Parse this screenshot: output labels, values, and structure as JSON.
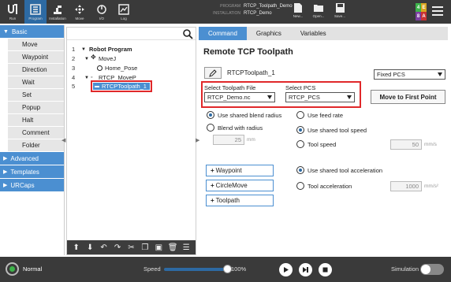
{
  "topbar": {
    "buttons": [
      {
        "label": "Run",
        "icon": "ur-logo-icon"
      },
      {
        "label": "Program",
        "icon": "program-icon"
      },
      {
        "label": "Installation",
        "icon": "installation-icon"
      },
      {
        "label": "Move",
        "icon": "move-icon"
      },
      {
        "label": "I/O",
        "icon": "io-icon"
      },
      {
        "label": "Log",
        "icon": "log-icon"
      }
    ],
    "program_key": "PROGRAM",
    "program_value": "RTCP_Toolpath_Demo",
    "installation_key": "INSTALLATION",
    "installation_value": "RTCP_Demo",
    "file_buttons": [
      {
        "label": "New...",
        "icon": "new-file-icon"
      },
      {
        "label": "Open...",
        "icon": "open-file-icon"
      },
      {
        "label": "Save...",
        "icon": "save-icon"
      }
    ],
    "tiles": [
      {
        "text": "4",
        "color": "#3db34a"
      },
      {
        "text": "E",
        "color": "#d9a520"
      },
      {
        "text": "8",
        "color": "#7b3fa0"
      },
      {
        "text": "A",
        "color": "#c83232"
      }
    ]
  },
  "leftnav": {
    "basic_label": "Basic",
    "items": [
      "Move",
      "Waypoint",
      "Direction",
      "Wait",
      "Set",
      "Popup",
      "Halt",
      "Comment",
      "Folder"
    ],
    "advanced_label": "Advanced",
    "templates_label": "Templates",
    "urcaps_label": "URCaps"
  },
  "tree": {
    "rows": [
      {
        "num": "1",
        "text": "Robot Program",
        "toggle": "▼"
      },
      {
        "num": "2",
        "text": "MoveJ",
        "toggle": "▼"
      },
      {
        "num": "3",
        "text": "Home_Pose",
        "toggle": ""
      },
      {
        "num": "4",
        "text": "RTCP_MoveP",
        "toggle": "▼"
      },
      {
        "num": "5",
        "text": "RTCPToolpath_1",
        "toggle": ""
      }
    ],
    "toolbar_icons": [
      "move-up-icon",
      "move-down-icon",
      "undo-icon",
      "redo-icon",
      "cut-icon",
      "copy-icon",
      "paste-icon",
      "delete-icon",
      "suppress-icon"
    ]
  },
  "tabs": [
    "Command",
    "Graphics",
    "Variables"
  ],
  "panel": {
    "title": "Remote TCP Toolpath",
    "node_name": "RTCPToolpath_1",
    "pcs_mode": "Fixed PCS",
    "toolpath_file_label": "Select Toolpath File",
    "toolpath_file_value": "RTCP_Demo.nc",
    "pcs_label": "Select PCS",
    "pcs_value": "RTCP_PCS",
    "move_first_point": "Move to First Point",
    "blend": {
      "shared_label": "Use shared blend radius",
      "radius_label": "Blend with radius",
      "radius_value": "25",
      "radius_unit": "mm",
      "shared_selected": true
    },
    "speed": {
      "feed_rate_label": "Use feed rate",
      "shared_label": "Use shared tool speed",
      "tool_label": "Tool speed",
      "tool_value": "50",
      "tool_unit": "mm/s",
      "selected": "shared"
    },
    "accel": {
      "shared_label": "Use shared tool acceleration",
      "tool_label": "Tool acceleration",
      "tool_value": "1000",
      "tool_unit": "mm/s²",
      "selected": "shared"
    },
    "add_buttons": [
      "Waypoint",
      "CircleMove",
      "Toolpath"
    ]
  },
  "bottombar": {
    "status": "Normal",
    "speed_label": "Speed",
    "speed_value": "100%",
    "speed_fraction": 1.0,
    "simulation_label": "Simulation",
    "simulation_on": false
  }
}
